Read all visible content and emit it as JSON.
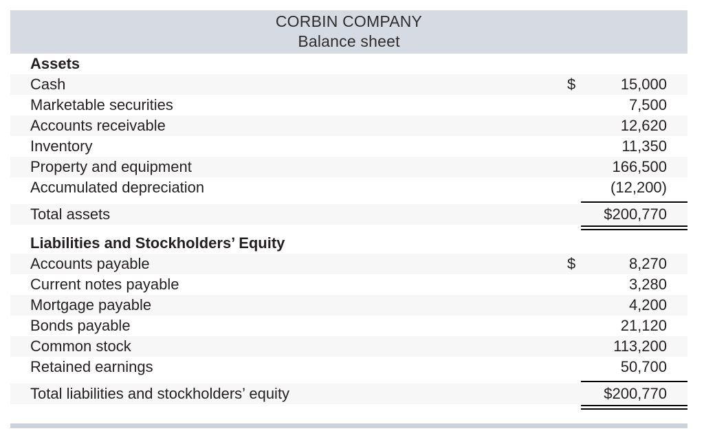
{
  "document": {
    "company_name": "CORBIN COMPANY",
    "statement_title": "Balance sheet"
  },
  "colors": {
    "title_band": "#d5dae3",
    "row_shaded": "#f7f7f7",
    "row_plain": "#ffffff",
    "bottom_bar": "#ccd2de",
    "text": "#231f20",
    "rule": "#000000"
  },
  "sections": {
    "assets": {
      "heading": "Assets",
      "line_items": [
        {
          "label": "Cash",
          "currency": "$",
          "amount": "15,000"
        },
        {
          "label": "Marketable securities",
          "currency": "",
          "amount": "7,500"
        },
        {
          "label": "Accounts receivable",
          "currency": "",
          "amount": "12,620"
        },
        {
          "label": "Inventory",
          "currency": "",
          "amount": "11,350"
        },
        {
          "label": "Property and equipment",
          "currency": "",
          "amount": "166,500"
        },
        {
          "label": "Accumulated depreciation",
          "currency": "",
          "amount": "(12,200)"
        }
      ],
      "total": {
        "label": "Total assets",
        "amount": "$200,770"
      }
    },
    "liabilities_equity": {
      "heading": "Liabilities and Stockholders’ Equity",
      "line_items": [
        {
          "label": "Accounts payable",
          "currency": "$",
          "amount": "8,270"
        },
        {
          "label": "Current notes payable",
          "currency": "",
          "amount": "3,280"
        },
        {
          "label": "Mortgage payable",
          "currency": "",
          "amount": "4,200"
        },
        {
          "label": "Bonds payable",
          "currency": "",
          "amount": "21,120"
        },
        {
          "label": "Common stock",
          "currency": "",
          "amount": "113,200"
        },
        {
          "label": "Retained earnings",
          "currency": "",
          "amount": "50,700"
        }
      ],
      "total": {
        "label": "Total liabilities and stockholders’ equity",
        "amount": "$200,770"
      }
    }
  }
}
